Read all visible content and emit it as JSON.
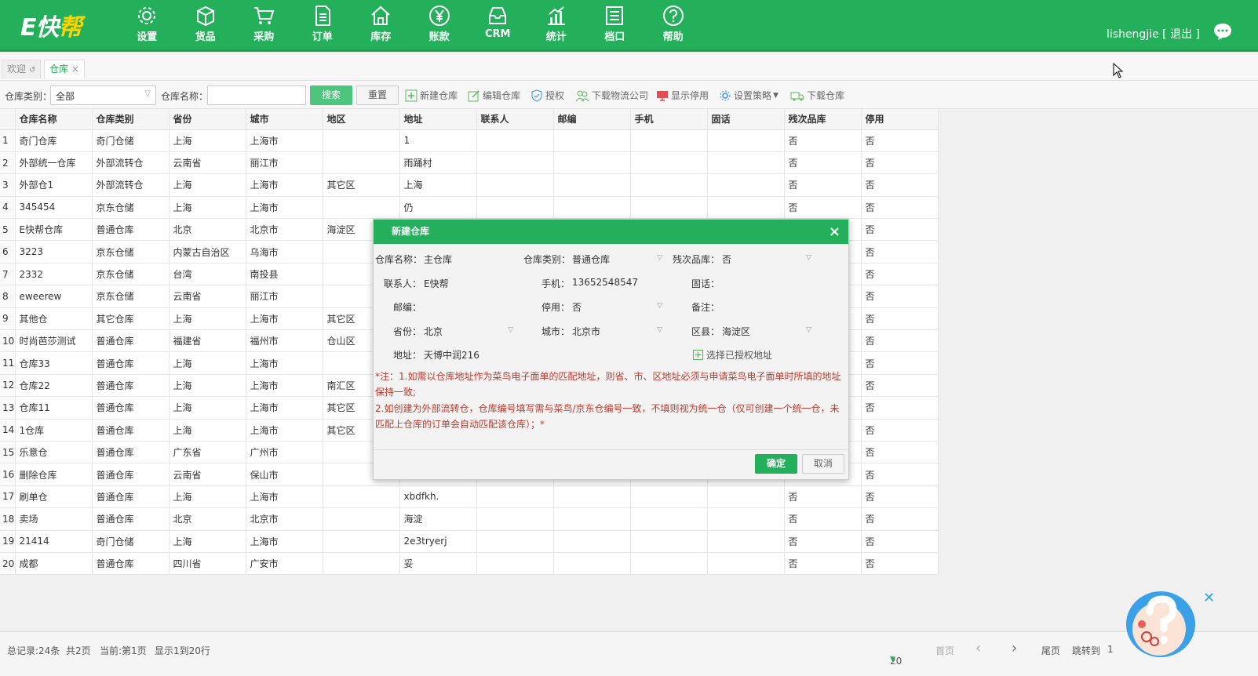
{
  "brand": {
    "logo_main": "E快",
    "logo_accent": "帮"
  },
  "nav": [
    {
      "label": "设置",
      "icon": "gear-icon"
    },
    {
      "label": "货品",
      "icon": "box-icon"
    },
    {
      "label": "采购",
      "icon": "cart-icon"
    },
    {
      "label": "订单",
      "icon": "document-icon"
    },
    {
      "label": "库存",
      "icon": "home-icon"
    },
    {
      "label": "账款",
      "icon": "yen-icon"
    },
    {
      "label": "CRM",
      "icon": "inbox-icon"
    },
    {
      "label": "统计",
      "icon": "bar-chart-icon"
    },
    {
      "label": "档口",
      "icon": "list-icon"
    },
    {
      "label": "帮助",
      "icon": "question-icon"
    }
  ],
  "user": {
    "name": "lishengjie",
    "logout": "[ 退出 ]"
  },
  "tabs": [
    {
      "label": "欢迎",
      "suffix": "↺"
    },
    {
      "label": "仓库",
      "suffix": "×"
    }
  ],
  "toolbar": {
    "type_label": "仓库类别：",
    "type_value": "全部",
    "name_label": "仓库名称：",
    "name_value": "",
    "search": "搜索",
    "reset": "重置",
    "tools": [
      "新建仓库",
      "编辑仓库",
      "授权",
      "下载物流公司",
      "显示停用",
      "设置策略",
      "下载仓库"
    ]
  },
  "table": {
    "headers": [
      "",
      "仓库名称",
      "仓库类别",
      "省份",
      "城市",
      "地区",
      "地址",
      "联系人",
      "邮编",
      "手机",
      "固话",
      "残次品库",
      "停用"
    ],
    "rows": [
      [
        "1",
        "奇门仓库",
        "奇门仓储",
        "上海",
        "上海市",
        "",
        "1",
        "",
        "",
        "",
        "",
        "否",
        "否"
      ],
      [
        "2",
        "外部统一仓库",
        "外部流转仓",
        "云南省",
        "丽江市",
        "",
        "雨踊村",
        "",
        "",
        "",
        "",
        "否",
        "否"
      ],
      [
        "3",
        "外部仓1",
        "外部流转仓",
        "上海",
        "上海市",
        "其它区",
        "上海",
        "",
        "",
        "",
        "",
        "否",
        "否"
      ],
      [
        "4",
        "345454",
        "京东仓储",
        "上海",
        "上海市",
        "",
        "仍",
        "",
        "",
        "",
        "",
        "否",
        "否"
      ],
      [
        "5",
        "E快帮仓库",
        "普通仓库",
        "北京",
        "北京市",
        "海淀区",
        "",
        "",
        "",
        "",
        "",
        "",
        "否"
      ],
      [
        "6",
        "3223",
        "京东仓储",
        "内蒙古自治区",
        "乌海市",
        "",
        "",
        "",
        "",
        "",
        "",
        "",
        "否"
      ],
      [
        "7",
        "2332",
        "京东仓储",
        "台湾",
        "南投县",
        "",
        "",
        "",
        "",
        "",
        "",
        "",
        "否"
      ],
      [
        "8",
        "eweerew",
        "京东仓储",
        "云南省",
        "丽江市",
        "",
        "",
        "",
        "",
        "",
        "",
        "",
        "否"
      ],
      [
        "9",
        "其他仓",
        "其它仓库",
        "上海",
        "上海市",
        "其它区",
        "",
        "",
        "",
        "",
        "",
        "",
        "否"
      ],
      [
        "10",
        "时尚芭莎测试",
        "普通仓库",
        "福建省",
        "福州市",
        "仓山区",
        "",
        "",
        "",
        "",
        "",
        "",
        "否"
      ],
      [
        "11",
        "仓库33",
        "普通仓库",
        "上海",
        "上海市",
        "",
        "",
        "",
        "",
        "",
        "",
        "",
        "否"
      ],
      [
        "12",
        "仓库22",
        "普通仓库",
        "上海",
        "上海市",
        "南汇区",
        "",
        "",
        "",
        "",
        "",
        "",
        "否"
      ],
      [
        "13",
        "仓库11",
        "普通仓库",
        "上海",
        "上海市",
        "其它区",
        "",
        "",
        "",
        "",
        "",
        "",
        "否"
      ],
      [
        "14",
        "1仓库",
        "普通仓库",
        "上海",
        "上海市",
        "其它区",
        "",
        "",
        "",
        "",
        "",
        "",
        "否"
      ],
      [
        "15",
        "乐意仓",
        "普通仓库",
        "广东省",
        "广州市",
        "",
        "",
        "",
        "",
        "",
        "",
        "",
        "否"
      ],
      [
        "16",
        "删除仓库",
        "普通仓库",
        "云南省",
        "保山市",
        "",
        "",
        "",
        "",
        "",
        "",
        "",
        "否"
      ],
      [
        "17",
        "刷单仓",
        "普通仓库",
        "上海",
        "上海市",
        "",
        "xbdfkh.",
        "",
        "",
        "",
        "",
        "否",
        "否"
      ],
      [
        "18",
        "卖场",
        "普通仓库",
        "北京",
        "北京市",
        "",
        "海淀",
        "",
        "",
        "",
        "",
        "否",
        "否"
      ],
      [
        "19",
        "21414",
        "奇门仓储",
        "上海",
        "上海市",
        "",
        "2e3tryerj",
        "",
        "",
        "",
        "",
        "否",
        "否"
      ],
      [
        "20",
        "成都",
        "普通仓库",
        "四川省",
        "广安市",
        "",
        "妥",
        "",
        "",
        "",
        "",
        "否",
        "否"
      ]
    ]
  },
  "footer": {
    "total": "总记录:24条",
    "pages": "共2页",
    "current": "当前:第1页",
    "showing": "显示1到20行",
    "page_size": "20",
    "first": "首页",
    "prev": "‹",
    "next": "›",
    "last": "尾页",
    "jump_label": "跳转到",
    "jump_value": "1"
  },
  "modal": {
    "title": "新建仓库",
    "close": "×",
    "fields": {
      "name_label": "仓库名称：",
      "name_value": "主仓库",
      "type_label": "仓库类别：",
      "type_value": "普通仓库",
      "defect_label": "残次品库：",
      "defect_value": "否",
      "contact_label": "联系人：",
      "contact_value": "E快帮",
      "mobile_label": "手机：",
      "mobile_value": "13652548547",
      "phone_label": "固话：",
      "phone_value": "",
      "zip_label": "邮编：",
      "zip_value": "",
      "disabled_label": "停用：",
      "disabled_value": "否",
      "remark_label": "备注：",
      "remark_value": "",
      "province_label": "省份：",
      "province_value": "北京",
      "city_label": "城市：",
      "city_value": "北京市",
      "district_label": "区县：",
      "district_value": "海淀区",
      "address_label": "地址：",
      "address_value": "天博中润216",
      "auth_address": "选择已授权地址"
    },
    "note1": "*注：1.如需以仓库地址作为菜鸟电子面单的匹配地址，则省、市、区地址必须与申请菜鸟电子面单时所填的地址保持一致;",
    "note2": "2.如创建为外部流转仓，仓库编号填写需与菜鸟/京东仓编号一致，不填则视为统一仓（仅可创建一个统一仓，未匹配上仓库的订单会自动匹配该仓库）；*",
    "ok": "确定",
    "cancel": "取消"
  },
  "colors": {
    "primary": "#24b05a",
    "note": "#c0392b"
  }
}
